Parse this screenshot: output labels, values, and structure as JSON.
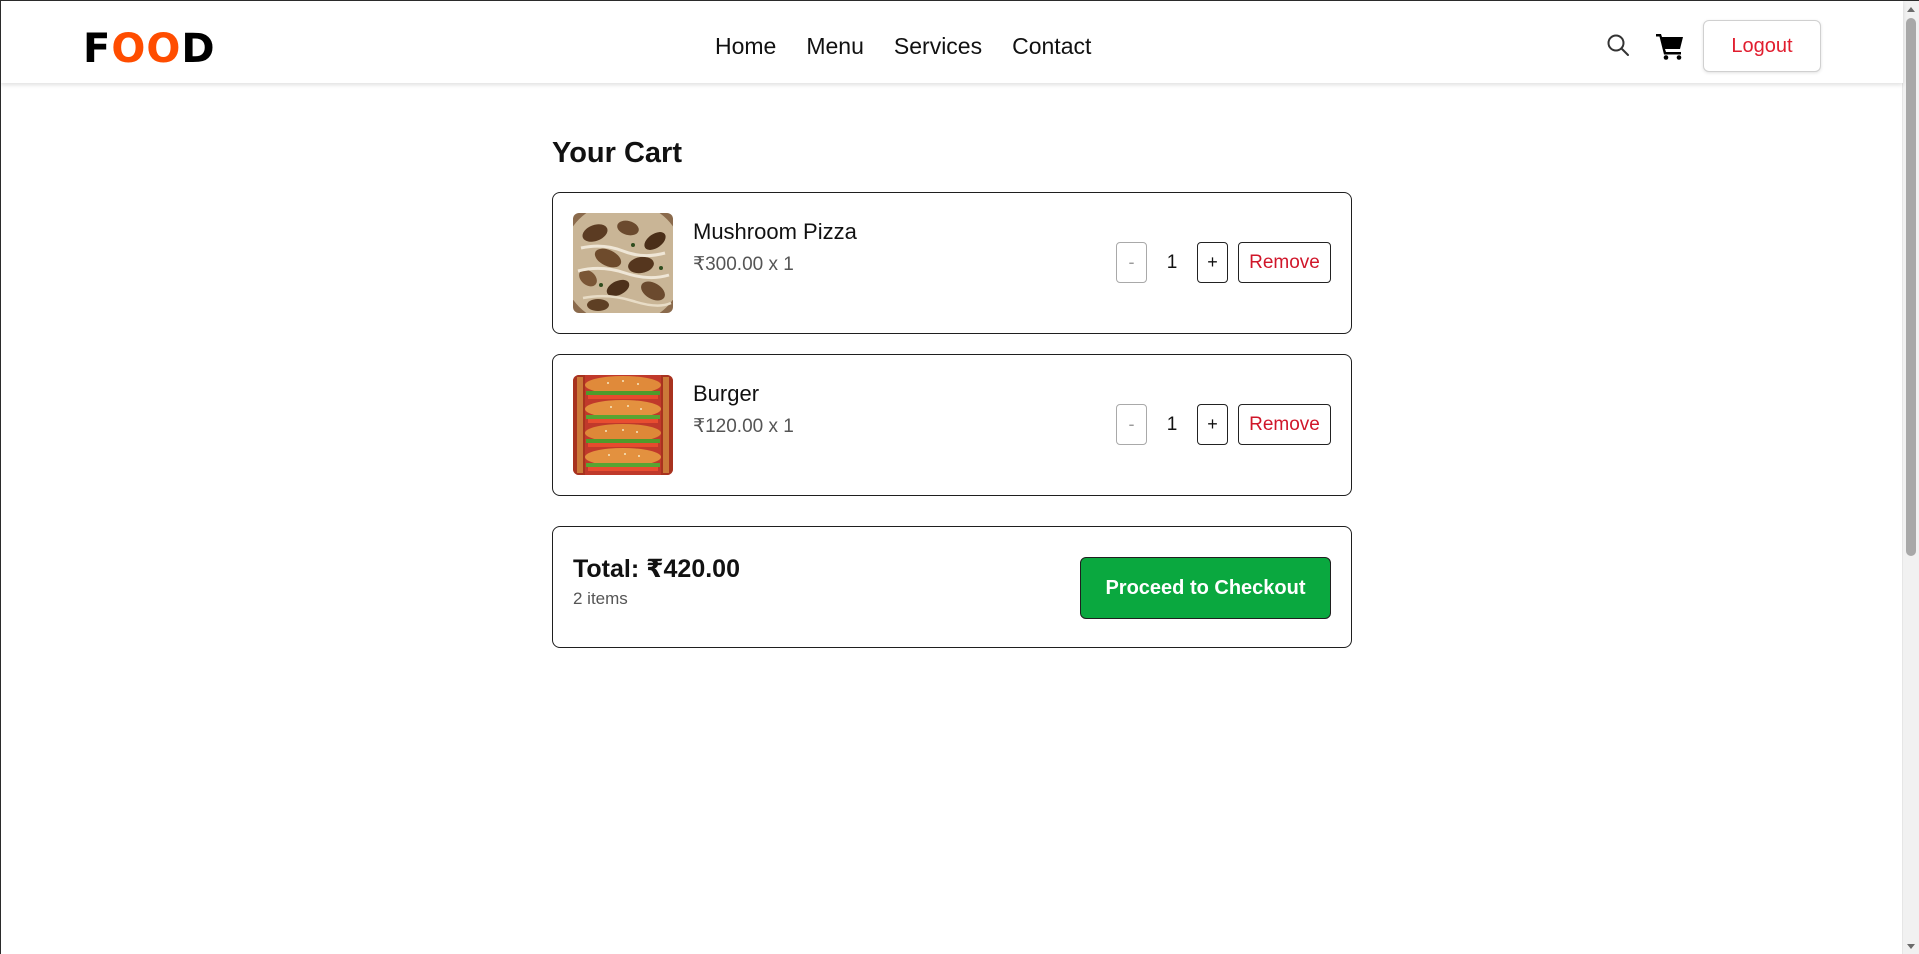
{
  "header": {
    "logo": {
      "part1": "F",
      "part2": "OO",
      "part3": "D"
    },
    "nav": [
      {
        "label": "Home"
      },
      {
        "label": "Menu"
      },
      {
        "label": "Services"
      },
      {
        "label": "Contact"
      }
    ],
    "icons": {
      "search": "search-icon",
      "cart": "cart-icon"
    },
    "logout_label": "Logout"
  },
  "cart": {
    "title": "Your Cart",
    "items": [
      {
        "name": "Mushroom Pizza",
        "price_line": "₹300.00 x 1",
        "quantity": "1",
        "minus_label": "-",
        "plus_label": "+",
        "remove_label": "Remove"
      },
      {
        "name": "Burger",
        "price_line": "₹120.00 x 1",
        "quantity": "1",
        "minus_label": "-",
        "plus_label": "+",
        "remove_label": "Remove"
      }
    ],
    "summary": {
      "total": "Total: ₹420.00",
      "count": "2 items",
      "checkout_label": "Proceed to Checkout"
    }
  },
  "colors": {
    "brand_orange": "#ff4d00",
    "checkout_green": "#0aa83f",
    "remove_red": "#d0162a",
    "logout_red": "#e11d2e"
  }
}
